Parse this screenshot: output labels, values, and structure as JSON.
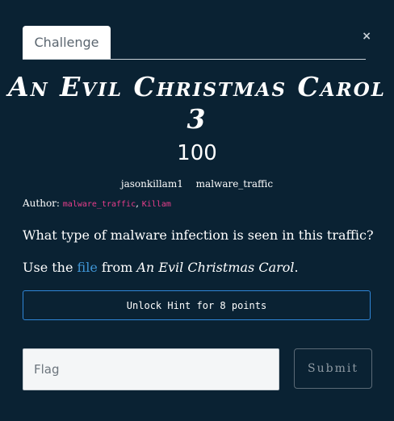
{
  "tabs": [
    {
      "label": "Challenge",
      "active": true
    }
  ],
  "close_glyph": "×",
  "challenge": {
    "title_line1": "An Evil Christmas Carol",
    "title_line2": "3",
    "points": "100",
    "tags": [
      "jasonkillam1",
      "malware_traffic"
    ],
    "author_label": "Author:",
    "authors": [
      "malware_traffic",
      "Killam"
    ],
    "author_separator": ",",
    "description": "What type of malware infection is seen in this traffic?",
    "use_prefix": "Use the",
    "file_link": "file",
    "use_middle": "from",
    "source_title": "An Evil Christmas Carol",
    "use_suffix": "."
  },
  "hint": {
    "label": "Unlock Hint for 8 points"
  },
  "flag": {
    "placeholder": "Flag",
    "value": ""
  },
  "submit": {
    "label": "Submit"
  },
  "colors": {
    "background": "#0a2233",
    "link": "#3f95d5",
    "author_code": "#e83e8c",
    "hint_border": "#2f86d8"
  },
  "icons": {
    "close": "close-icon"
  }
}
